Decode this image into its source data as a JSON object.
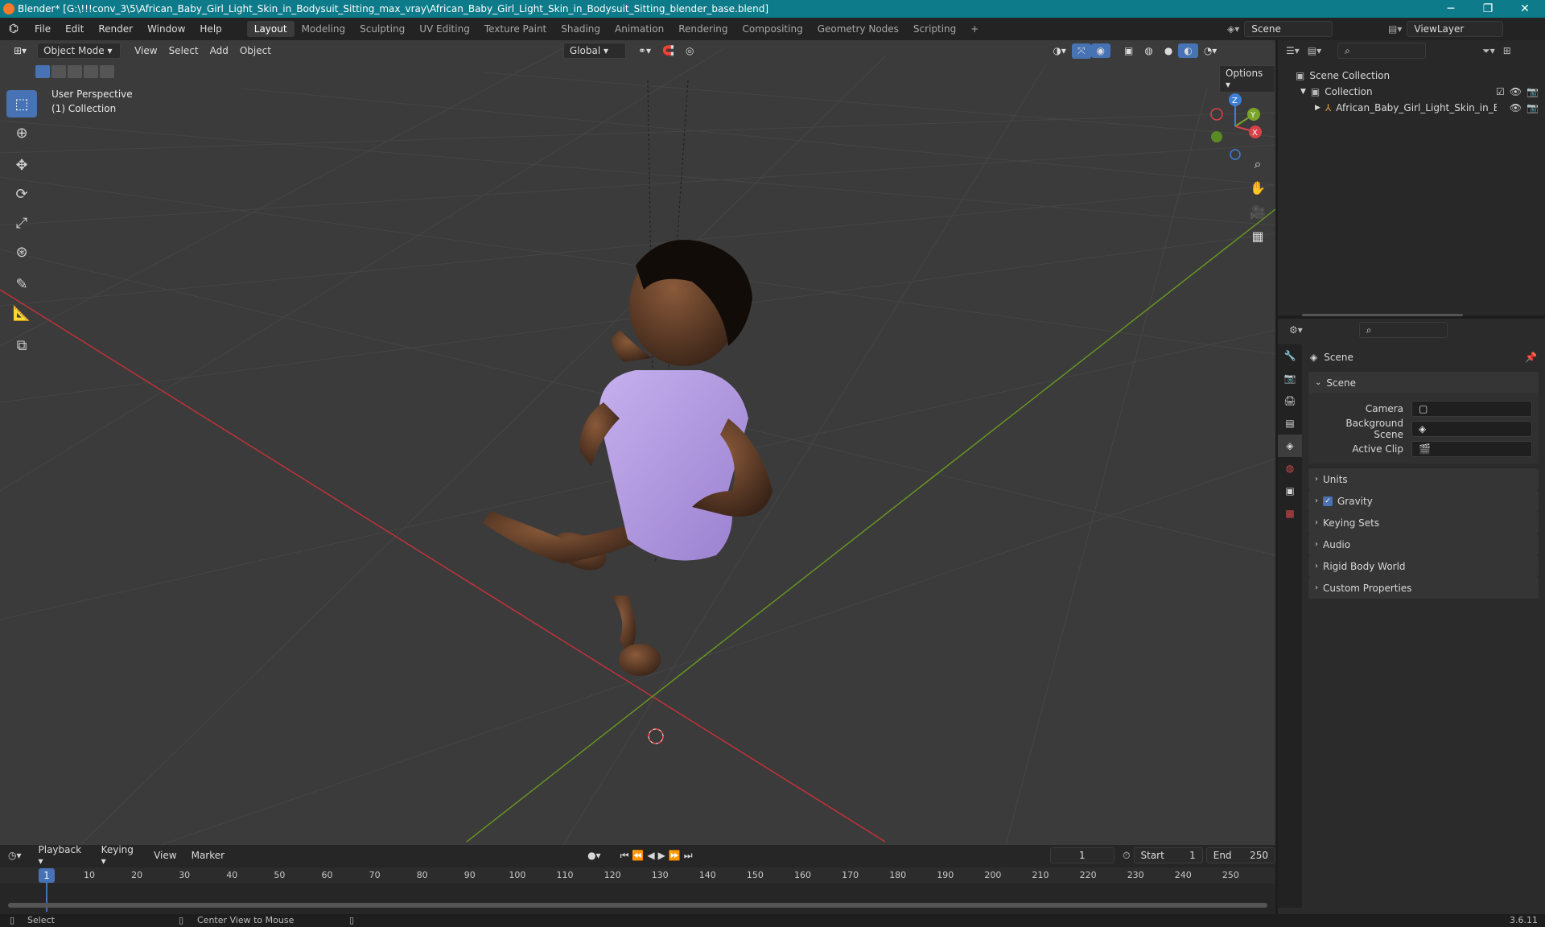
{
  "window": {
    "title": "Blender* [G:\\!!!conv_3\\5\\African_Baby_Girl_Light_Skin_in_Bodysuit_Sitting_max_vray\\African_Baby_Girl_Light_Skin_in_Bodysuit_Sitting_blender_base.blend]",
    "minimize": "─",
    "maximize": "❐",
    "close": "✕"
  },
  "menu": {
    "items": [
      "File",
      "Edit",
      "Render",
      "Window",
      "Help"
    ],
    "workspaces": [
      "Layout",
      "Modeling",
      "Sculpting",
      "UV Editing",
      "Texture Paint",
      "Shading",
      "Animation",
      "Rendering",
      "Compositing",
      "Geometry Nodes",
      "Scripting"
    ],
    "active_workspace": "Layout",
    "add_workspace": "+",
    "scene_label": "Scene",
    "viewlayer_label": "ViewLayer"
  },
  "viewport": {
    "mode": "Object Mode",
    "menus": [
      "View",
      "Select",
      "Add",
      "Object"
    ],
    "transform_orientation": "Global",
    "options_label": "Options",
    "perspective_label": "User Perspective",
    "collection_label": "(1) Collection",
    "gizmo": {
      "z": "Z",
      "y": "Y",
      "x": "X"
    }
  },
  "outliner": {
    "root": "Scene Collection",
    "collection": "Collection",
    "object": "African_Baby_Girl_Light_Skin_in_Bo"
  },
  "properties": {
    "context_title": "Scene",
    "panel_title": "Scene",
    "fields": [
      {
        "label": "Camera"
      },
      {
        "label": "Background Scene"
      },
      {
        "label": "Active Clip"
      }
    ],
    "sections": [
      "Units",
      "Gravity",
      "Keying Sets",
      "Audio",
      "Rigid Body World",
      "Custom Properties"
    ]
  },
  "timeline": {
    "menus": [
      "Playback",
      "Keying",
      "View",
      "Marker"
    ],
    "current_frame": "1",
    "start_label": "Start",
    "start_value": "1",
    "end_label": "End",
    "end_value": "250",
    "ruler": [
      "10",
      "20",
      "30",
      "40",
      "50",
      "60",
      "70",
      "80",
      "90",
      "100",
      "110",
      "120",
      "130",
      "140",
      "150",
      "160",
      "170",
      "180",
      "190",
      "200",
      "210",
      "220",
      "230",
      "240",
      "250"
    ]
  },
  "status": {
    "select": "Select",
    "center_view": "Center View to Mouse",
    "version": "3.6.11"
  },
  "colors": {
    "titlebar": "#0e7b8a",
    "accent": "#4772b3",
    "x_axis": "#c8323a",
    "y_axis": "#6a9a1f",
    "bodysuit": "#b59be0"
  }
}
